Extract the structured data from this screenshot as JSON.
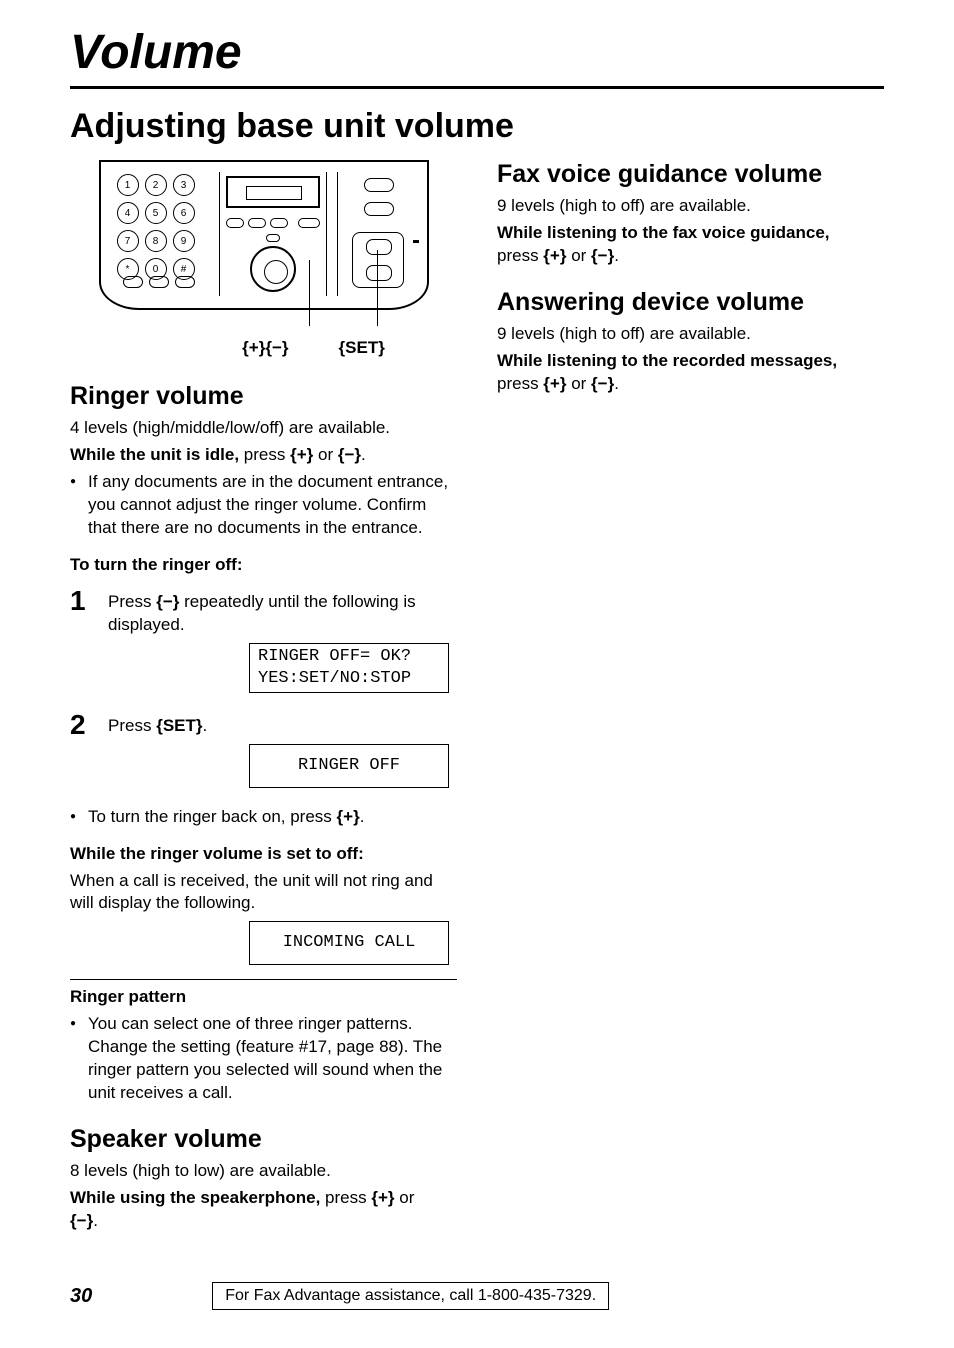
{
  "chapter": "Volume",
  "section": "Adjusting base unit volume",
  "diagram": {
    "label_volume": "{+}{-}",
    "label_set": "{SET}"
  },
  "ringer": {
    "heading": "Ringer volume",
    "levels": "4 levels (high/middle/low/off) are available.",
    "idle_bold": "While the unit is idle,",
    "idle_rest": " press ",
    "idle_end": " or ",
    "bullet1": "If any documents are in the document entrance, you cannot adjust the ringer volume. Confirm that there are no documents in the entrance.",
    "turn_off_heading": "To turn the ringer off:",
    "step1_a": "Press ",
    "step1_b": " repeatedly until the following is displayed.",
    "display1_line1": "RINGER OFF= OK?",
    "display1_line2": "YES:SET/NO:STOP",
    "step2_a": "Press ",
    "step2_key": "{SET}",
    "step2_b": ".",
    "display2": "RINGER OFF",
    "back_on_a": "To turn the ringer back on, press ",
    "back_on_b": ".",
    "while_off_heading": "While the ringer volume is set to off:",
    "while_off_body": "When a call is received, the unit will not ring and will display the following.",
    "display3": "INCOMING CALL",
    "pattern_heading": "Ringer pattern",
    "pattern_bullet": "You can select one of three ringer patterns. Change the setting (feature #17, page 88). The ringer pattern you selected will sound when the unit receives a call."
  },
  "speaker": {
    "heading": "Speaker volume",
    "levels": "8 levels (high to low) are available.",
    "bold": "While using the speakerphone,",
    "rest": " press ",
    "mid": " or ",
    "end": "."
  },
  "fax": {
    "heading": "Fax voice guidance volume",
    "levels": "9 levels (high to off) are available.",
    "bold": "While listening to the fax voice guidance,",
    "rest": "press ",
    "mid": " or ",
    "end": "."
  },
  "answering": {
    "heading": "Answering device volume",
    "levels": "9 levels (high to off) are available.",
    "bold": "While listening to the recorded messages,",
    "rest": "press ",
    "mid": " or ",
    "end": "."
  },
  "keys": {
    "plus": "{+}",
    "minus": "{-}",
    "set": "{SET}"
  },
  "footer": {
    "page": "30",
    "assistance": "For Fax Advantage assistance, call 1-800-435-7329."
  }
}
